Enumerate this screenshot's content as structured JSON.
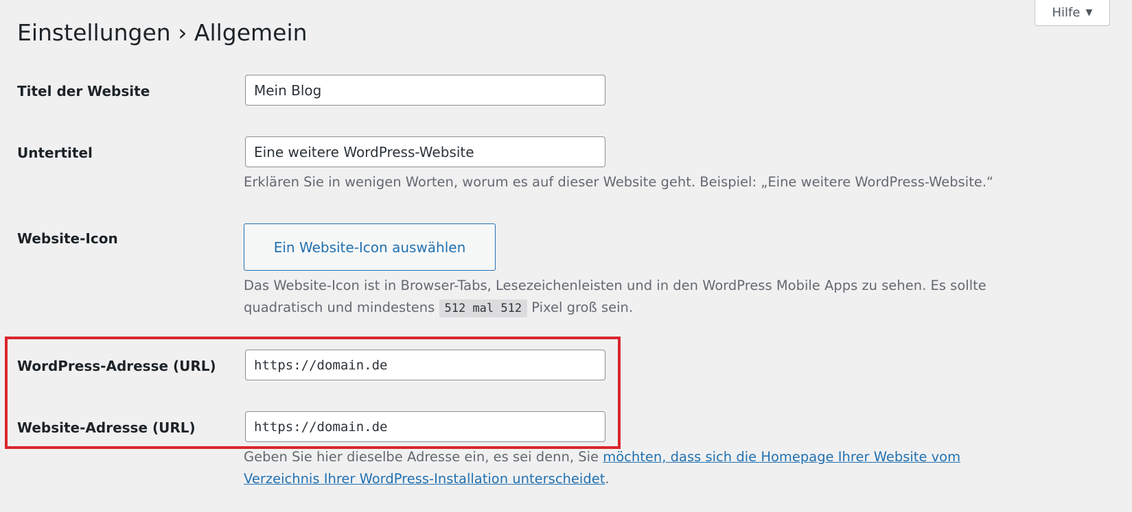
{
  "header": {
    "title": "Einstellungen › Allgemein",
    "help_label": "Hilfe"
  },
  "fields": {
    "site_title": {
      "label": "Titel der Website",
      "value": "Mein Blog"
    },
    "tagline": {
      "label": "Untertitel",
      "value": "Eine weitere WordPress-Website",
      "description": "Erklären Sie in wenigen Worten, worum es auf dieser Website geht. Beispiel: „Eine weitere WordPress-Website.“"
    },
    "site_icon": {
      "label": "Website-Icon",
      "button_label": "Ein Website-Icon auswählen",
      "description_part1": "Das Website-Icon ist in Browser-Tabs, Lesezeichenleisten und in den WordPress Mobile Apps zu sehen. Es sollte quadratisch und mindestens ",
      "description_code": "512 mal 512",
      "description_part2": " Pixel groß sein."
    },
    "wp_address": {
      "label": "WordPress-Adresse (URL)",
      "value": "https://domain.de"
    },
    "site_address": {
      "label": "Website-Adresse (URL)",
      "value": "https://domain.de",
      "description_part1": "Geben Sie hier dieselbe Adresse ein, es sei denn, Sie ",
      "description_link": "möchten, dass sich die Homepage Ihrer Website vom Verzeichnis Ihrer WordPress-Installation unterscheidet",
      "description_part2": "."
    }
  },
  "annotation": {
    "highlight_color": "#d9262c"
  },
  "colors": {
    "background": "#f0f0f1",
    "accent": "#2271b1",
    "text": "#1d2327",
    "muted_text": "#646970"
  }
}
